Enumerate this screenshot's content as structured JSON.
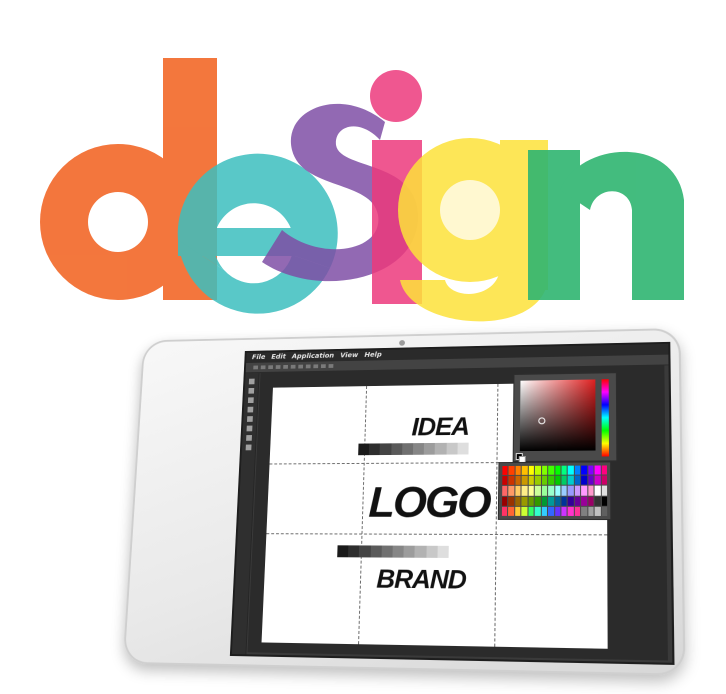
{
  "hero": {
    "word_letters": [
      {
        "char": "d",
        "color": "#f26b2d"
      },
      {
        "char": "e",
        "color": "#3cbfbf"
      },
      {
        "char": "s",
        "color": "#7f4fa6"
      },
      {
        "char": "i",
        "color": "#ec3a7c"
      },
      {
        "char": "g",
        "color": "#fde23a"
      },
      {
        "char": "n",
        "color": "#2fb571"
      }
    ]
  },
  "app": {
    "menu": [
      "File",
      "Edit",
      "Application",
      "View",
      "Help"
    ],
    "document": {
      "word_top": "IDEA",
      "word_middle": "LOGO",
      "word_bottom": "BRAND"
    },
    "grayscale_ramp": [
      "#1a1a1a",
      "#2e2e2e",
      "#444444",
      "#5a5a5a",
      "#707070",
      "#868686",
      "#9c9c9c",
      "#b2b2b2",
      "#c8c8c8",
      "#dedede"
    ],
    "swatch_colors": [
      "#ff0000",
      "#ff4000",
      "#ff8000",
      "#ffbf00",
      "#ffff00",
      "#bfff00",
      "#80ff00",
      "#40ff00",
      "#00ff00",
      "#00ff80",
      "#00ffff",
      "#0080ff",
      "#0000ff",
      "#8000ff",
      "#ff00ff",
      "#ff0080",
      "#cc0000",
      "#cc3300",
      "#cc6600",
      "#cc9900",
      "#cccc00",
      "#99cc00",
      "#66cc00",
      "#33cc00",
      "#00cc00",
      "#00cc66",
      "#00cccc",
      "#0066cc",
      "#0000cc",
      "#6600cc",
      "#cc00cc",
      "#cc0066",
      "#ff6666",
      "#ff9966",
      "#ffcc66",
      "#ffee88",
      "#ffff99",
      "#ccff99",
      "#99ff99",
      "#99ffcc",
      "#99ffff",
      "#99ccff",
      "#9999ff",
      "#cc99ff",
      "#ff99ff",
      "#ff99cc",
      "#ffffff",
      "#e0e0e0",
      "#990000",
      "#993300",
      "#996600",
      "#999900",
      "#669900",
      "#339900",
      "#009933",
      "#009999",
      "#006699",
      "#003399",
      "#330099",
      "#660099",
      "#990099",
      "#990066",
      "#333333",
      "#000000",
      "#ff3366",
      "#ff6633",
      "#ffcc33",
      "#ccff33",
      "#33ff66",
      "#33ffcc",
      "#33ccff",
      "#3366ff",
      "#6633ff",
      "#cc33ff",
      "#ff33cc",
      "#ff3399",
      "#808080",
      "#a0a0a0",
      "#c0c0c0",
      "#606060"
    ]
  }
}
